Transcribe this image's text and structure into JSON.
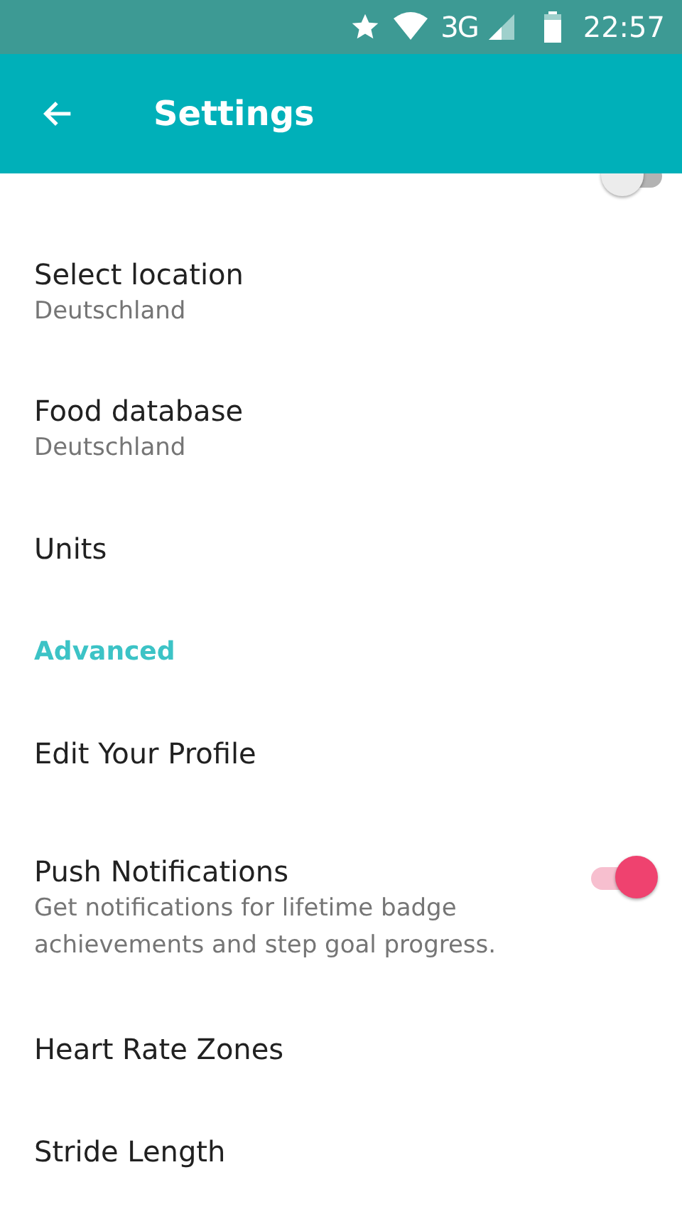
{
  "status_bar": {
    "network": "3G",
    "time": "22:57"
  },
  "app_bar": {
    "title": "Settings"
  },
  "items": [
    {
      "kind": "toggle",
      "on": false
    },
    {
      "kind": "item",
      "title": "Select location",
      "subtitle": "Deutschland"
    },
    {
      "kind": "item",
      "title": "Food database",
      "subtitle": "Deutschland"
    },
    {
      "kind": "item",
      "title": "Units"
    },
    {
      "kind": "header",
      "title": "Advanced"
    },
    {
      "kind": "item",
      "title": "Edit Your Profile"
    },
    {
      "kind": "switch",
      "title": "Push Notifications",
      "subtitle": "Get notifications for lifetime badge achievements and step goal progress.",
      "on": true
    },
    {
      "kind": "item",
      "title": "Heart Rate Zones"
    },
    {
      "kind": "item",
      "title": "Stride Length"
    }
  ]
}
